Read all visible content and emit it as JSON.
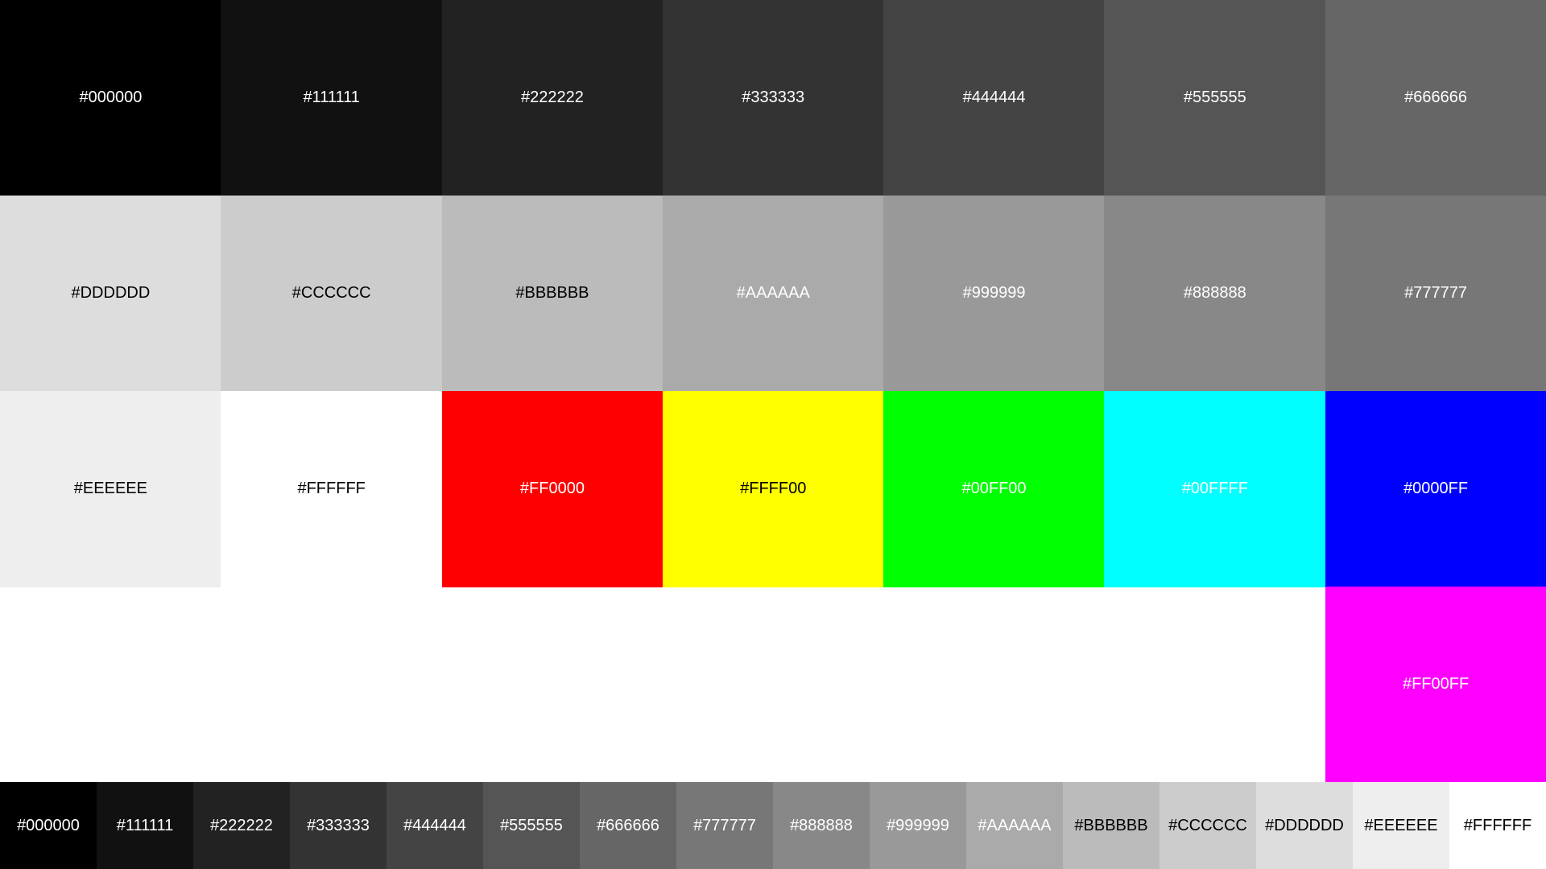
{
  "grid": {
    "rows": [
      [
        {
          "label": "#000000",
          "color": "#000000",
          "text_color": "#FFFFFF"
        },
        {
          "label": "#111111",
          "color": "#111111",
          "text_color": "#FFFFFF"
        },
        {
          "label": "#222222",
          "color": "#222222",
          "text_color": "#FFFFFF"
        },
        {
          "label": "#333333",
          "color": "#333333",
          "text_color": "#FFFFFF"
        },
        {
          "label": "#444444",
          "color": "#444444",
          "text_color": "#FFFFFF"
        },
        {
          "label": "#555555",
          "color": "#555555",
          "text_color": "#FFFFFF"
        },
        {
          "label": "#666666",
          "color": "#666666",
          "text_color": "#FFFFFF"
        }
      ],
      [
        {
          "label": "#DDDDDD",
          "color": "#DDDDDD",
          "text_color": "#000000"
        },
        {
          "label": "#CCCCCC",
          "color": "#CCCCCC",
          "text_color": "#000000"
        },
        {
          "label": "#BBBBBB",
          "color": "#BBBBBB",
          "text_color": "#000000"
        },
        {
          "label": "#AAAAAA",
          "color": "#AAAAAA",
          "text_color": "#FFFFFF"
        },
        {
          "label": "#999999",
          "color": "#999999",
          "text_color": "#FFFFFF"
        },
        {
          "label": "#888888",
          "color": "#888888",
          "text_color": "#FFFFFF"
        },
        {
          "label": "#777777",
          "color": "#777777",
          "text_color": "#FFFFFF"
        }
      ],
      [
        {
          "label": "#EEEEEE",
          "color": "#EEEEEE",
          "text_color": "#000000"
        },
        {
          "label": "#FFFFFF",
          "color": "#FFFFFF",
          "text_color": "#000000"
        },
        {
          "label": "#FF0000",
          "color": "#FF0000",
          "text_color": "#FFFFFF"
        },
        {
          "label": "#FFFF00",
          "color": "#FFFF00",
          "text_color": "#000000"
        },
        {
          "label": "#00FF00",
          "color": "#00FF00",
          "text_color": "#FFFFFF"
        },
        {
          "label": "#00FFFF",
          "color": "#00FFFF",
          "text_color": "#FFFFFF"
        },
        {
          "label": "#0000FF",
          "color": "#0000FF",
          "text_color": "#FFFFFF"
        }
      ],
      [
        null,
        null,
        null,
        null,
        null,
        null,
        {
          "label": "#FF00FF",
          "color": "#FF00FF",
          "text_color": "#FFFFFF"
        }
      ]
    ]
  },
  "bottom_strip": [
    {
      "label": "#000000",
      "color": "#000000",
      "text_color": "#FFFFFF"
    },
    {
      "label": "#111111",
      "color": "#111111",
      "text_color": "#FFFFFF"
    },
    {
      "label": "#222222",
      "color": "#222222",
      "text_color": "#FFFFFF"
    },
    {
      "label": "#333333",
      "color": "#333333",
      "text_color": "#FFFFFF"
    },
    {
      "label": "#444444",
      "color": "#444444",
      "text_color": "#FFFFFF"
    },
    {
      "label": "#555555",
      "color": "#555555",
      "text_color": "#FFFFFF"
    },
    {
      "label": "#666666",
      "color": "#666666",
      "text_color": "#FFFFFF"
    },
    {
      "label": "#777777",
      "color": "#777777",
      "text_color": "#FFFFFF"
    },
    {
      "label": "#888888",
      "color": "#888888",
      "text_color": "#FFFFFF"
    },
    {
      "label": "#999999",
      "color": "#999999",
      "text_color": "#FFFFFF"
    },
    {
      "label": "#AAAAAA",
      "color": "#AAAAAA",
      "text_color": "#FFFFFF"
    },
    {
      "label": "#BBBBBB",
      "color": "#BBBBBB",
      "text_color": "#000000"
    },
    {
      "label": "#CCCCCC",
      "color": "#CCCCCC",
      "text_color": "#000000"
    },
    {
      "label": "#DDDDDD",
      "color": "#DDDDDD",
      "text_color": "#000000"
    },
    {
      "label": "#EEEEEE",
      "color": "#EEEEEE",
      "text_color": "#000000"
    },
    {
      "label": "#FFFFFF",
      "color": "#FFFFFF",
      "text_color": "#000000"
    }
  ]
}
